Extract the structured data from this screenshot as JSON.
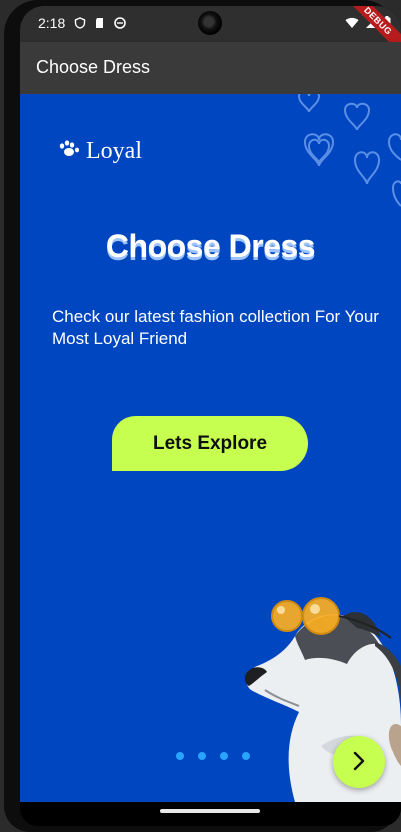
{
  "status_bar": {
    "time": "2:18",
    "debug_label": "DEBUG",
    "left_icons": [
      "shield-icon",
      "sd-card-icon",
      "android-icon"
    ],
    "right_icons": [
      "wifi-icon",
      "signal-icon",
      "battery-icon"
    ]
  },
  "app_bar": {
    "title": "Choose Dress"
  },
  "onboarding": {
    "logo_text": "Loyal",
    "logo_icon": "paw-icon",
    "heading": "Choose Dress",
    "subtitle": "Check our latest fashion collection For Your Most Loyal Friend",
    "cta_label": "Lets Explore",
    "page_dots": 4,
    "next_icon": "chevron-right-icon"
  },
  "colors": {
    "background": "#0046C0",
    "accent": "#C6FF4F",
    "dot": "#2AA3FF",
    "appbar": "#3A3A3A"
  }
}
